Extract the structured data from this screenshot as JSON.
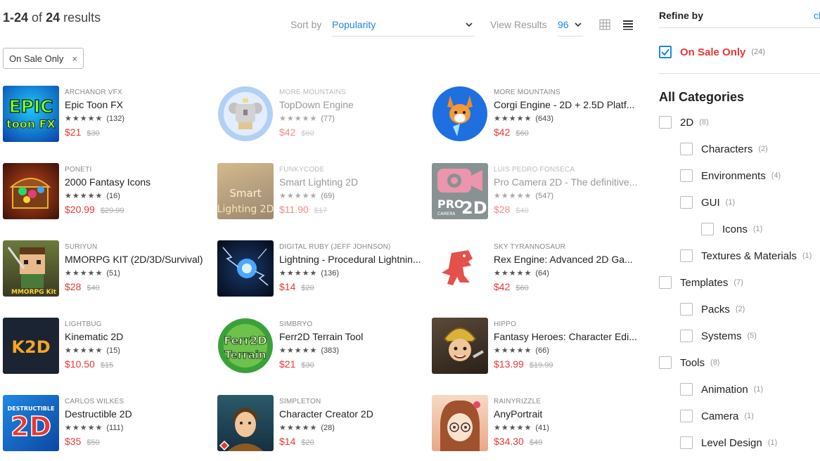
{
  "header": {
    "range": "1-24",
    "of_word": "of",
    "total": "24",
    "results_word": "results",
    "sort_label": "Sort by",
    "sort_value": "Popularity",
    "view_label": "View Results",
    "view_value": "96"
  },
  "active_filter": {
    "label": "On Sale Only",
    "remove": "×"
  },
  "products": [
    {
      "publisher": "ARCHANOR VFX",
      "title": "Epic Toon FX",
      "reviews": "(132)",
      "price": "$21",
      "original": "$30",
      "rating": 5,
      "dim": false
    },
    {
      "publisher": "MORE MOUNTAINS",
      "title": "TopDown Engine",
      "reviews": "(77)",
      "price": "$42",
      "original": "$60",
      "rating": 5,
      "dim": true
    },
    {
      "publisher": "MORE MOUNTAINS",
      "title": "Corgi Engine - 2D + 2.5D Platf...",
      "reviews": "(643)",
      "price": "$42",
      "original": "$60",
      "rating": 5,
      "dim": false
    },
    {
      "publisher": "PONETI",
      "title": "2000 Fantasy Icons",
      "reviews": "(16)",
      "price": "$20.99",
      "original": "$29.99",
      "rating": 5,
      "dim": false
    },
    {
      "publisher": "FUNKYCODE",
      "title": "Smart Lighting 2D",
      "reviews": "(69)",
      "price": "$11.90",
      "original": "$17",
      "rating": 5,
      "dim": true
    },
    {
      "publisher": "LUÍS PEDRO FONSECA",
      "title": "Pro Camera 2D - The definitive...",
      "reviews": "(547)",
      "price": "$28",
      "original": "$40",
      "rating": 5,
      "dim": true
    },
    {
      "publisher": "SURIYUN",
      "title": "MMORPG KIT (2D/3D/Survival)",
      "reviews": "(51)",
      "price": "$28",
      "original": "$40",
      "rating": 5,
      "dim": false
    },
    {
      "publisher": "DIGITAL RUBY (JEFF JOHNSON)",
      "title": "Lightning - Procedural Lightnin...",
      "reviews": "(136)",
      "price": "$14",
      "original": "$20",
      "rating": 5,
      "dim": false
    },
    {
      "publisher": "SKY TYRANNOSAUR",
      "title": "Rex Engine: Advanced 2D Ga...",
      "reviews": "(64)",
      "price": "$42",
      "original": "$60",
      "rating": 5,
      "dim": false
    },
    {
      "publisher": "LIGHTBUG",
      "title": "Kinematic 2D",
      "reviews": "(15)",
      "price": "$10.50",
      "original": "$15",
      "rating": 5,
      "dim": false
    },
    {
      "publisher": "SIMBRYO",
      "title": "Ferr2D Terrain Tool",
      "reviews": "(383)",
      "price": "$21",
      "original": "$30",
      "rating": 5,
      "dim": false
    },
    {
      "publisher": "HIPPO",
      "title": "Fantasy Heroes: Character Edi...",
      "reviews": "(66)",
      "price": "$13.99",
      "original": "$19.99",
      "rating": 5,
      "dim": false
    },
    {
      "publisher": "CARLOS WILKES",
      "title": "Destructible 2D",
      "reviews": "(111)",
      "price": "$35",
      "original": "$50",
      "rating": 5,
      "dim": false
    },
    {
      "publisher": "SIMPLETON",
      "title": "Character Creator 2D",
      "reviews": "(28)",
      "price": "$14",
      "original": "$20",
      "rating": 5,
      "dim": false
    },
    {
      "publisher": "RAINYRIZZLE",
      "title": "AnyPortrait",
      "reviews": "(41)",
      "price": "$34.30",
      "original": "$49",
      "rating": 5,
      "dim": false
    }
  ],
  "thumb_text": {
    "epic_line1": "EPIC",
    "epic_line2": "toon FX",
    "smart_line1": "Smart",
    "smart_line2": "Lighting 2D",
    "pro_line1": "PRO",
    "pro_line2": "2D",
    "pro_line3": "CAMERA",
    "mmorpg": "MMORPG Kit",
    "k2d": "K2D",
    "ferr_line1": "Ferr2D",
    "ferr_line2": "Terrain",
    "destructible_big": "2D",
    "destructible_small": "DESTRUCTIBLE"
  },
  "sidebar": {
    "refine_title": "Refine by",
    "clear_label": "cl",
    "on_sale_label": "On Sale Only",
    "on_sale_count": "(24)",
    "categories_title": "All Categories",
    "categories": [
      {
        "label": "2D",
        "count": "(8)",
        "level": 0
      },
      {
        "label": "Characters",
        "count": "(2)",
        "level": 1
      },
      {
        "label": "Environments",
        "count": "(4)",
        "level": 1
      },
      {
        "label": "GUI",
        "count": "(1)",
        "level": 1
      },
      {
        "label": "Icons",
        "count": "(1)",
        "level": 2
      },
      {
        "label": "Textures & Materials",
        "count": "(1)",
        "level": 1
      },
      {
        "label": "Templates",
        "count": "(7)",
        "level": 0
      },
      {
        "label": "Packs",
        "count": "(2)",
        "level": 1
      },
      {
        "label": "Systems",
        "count": "(5)",
        "level": 1
      },
      {
        "label": "Tools",
        "count": "(8)",
        "level": 0
      },
      {
        "label": "Animation",
        "count": "(1)",
        "level": 1
      },
      {
        "label": "Camera",
        "count": "(1)",
        "level": 1
      },
      {
        "label": "Level Design",
        "count": "(1)",
        "level": 1
      }
    ]
  },
  "colors": {
    "accent": "#1e88e5",
    "sale": "#e53935"
  }
}
